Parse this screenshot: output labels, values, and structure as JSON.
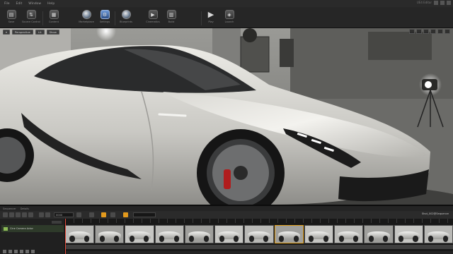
{
  "menu": {
    "items": [
      "File",
      "Edit",
      "Window",
      "Help"
    ],
    "window_title": "UE4 Editor"
  },
  "toolbar": {
    "buttons": [
      {
        "label": "Save",
        "icon": "save-icon"
      },
      {
        "label": "Source Control",
        "icon": "source-control-icon"
      },
      {
        "label": "Content",
        "icon": "content-icon"
      },
      {
        "label": "Marketplace",
        "icon": "marketplace-icon"
      },
      {
        "label": "Settings",
        "icon": "settings-icon"
      },
      {
        "label": "Blueprints",
        "icon": "blueprints-icon"
      },
      {
        "label": "Cinematics",
        "icon": "cinematics-icon"
      },
      {
        "label": "Build",
        "icon": "build-icon"
      },
      {
        "label": "Play",
        "icon": "play-icon"
      },
      {
        "label": "Launch",
        "icon": "launch-icon"
      }
    ]
  },
  "viewport": {
    "chips": [
      "Perspective",
      "Lit",
      "Show"
    ],
    "scene": "sports-car-render"
  },
  "sequencer": {
    "tabs": [
      "Sequencer",
      "Details"
    ],
    "time_field": "0000",
    "track_label": "Cine Camera Actor",
    "ruler_label": "Shot_002@Sequence",
    "thumbnail_count": 13,
    "selected_thumbnail": 7,
    "playhead_fraction": 0.0
  },
  "colors": {
    "accent": "#e39a1d",
    "track": "#8dbb57",
    "playhead": "#e94b3c"
  }
}
